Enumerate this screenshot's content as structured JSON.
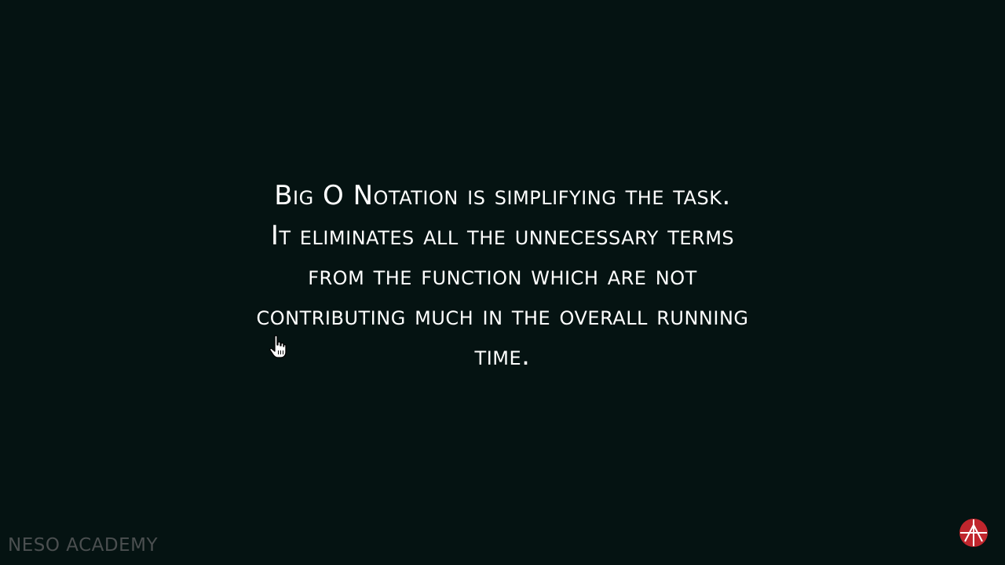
{
  "slide": {
    "lines": [
      "Big O Notation is simplifying the task.",
      "It eliminates all the unnecessary terms",
      "from the function which are not",
      "contributing much in the overall running",
      "time."
    ]
  },
  "watermark": {
    "label": "NESO ACADEMY"
  },
  "icons": {
    "cursor": "hand-pointer-icon",
    "logo": "neso-academy-logo-icon"
  },
  "colors": {
    "background": "#051312",
    "text": "#ffffff",
    "watermark": "#4b4f50",
    "logo": "#c0262d"
  }
}
